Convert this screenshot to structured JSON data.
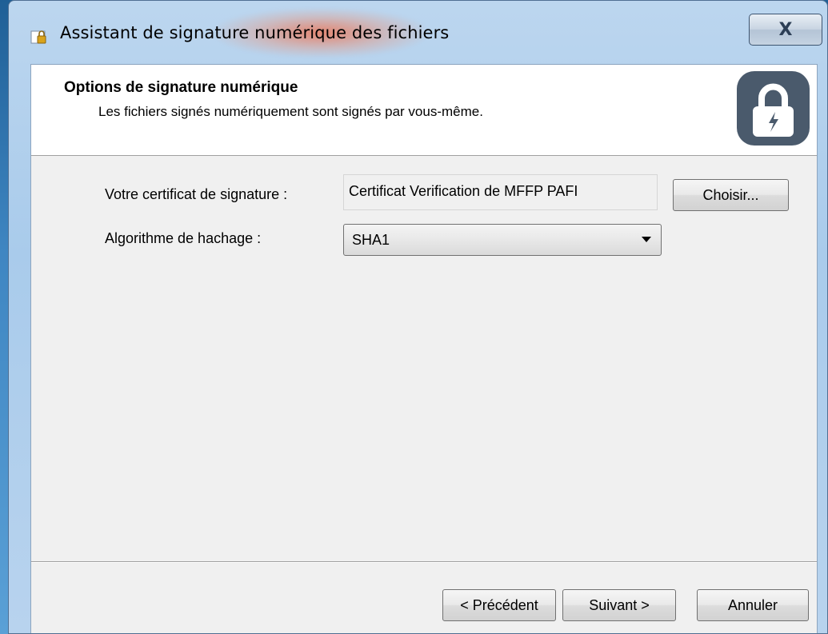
{
  "window": {
    "title": "Assistant de signature numérique des fichiers",
    "close_label": "X"
  },
  "header": {
    "title": "Options de signature numérique",
    "subtitle": "Les fichiers signés numériquement sont signés par vous-même.",
    "icon": "lock-icon"
  },
  "form": {
    "certificate_label": "Votre certificat de signature :",
    "certificate_value": "Certificat Verification de MFFP PAFI",
    "choose_label": "Choisir...",
    "hash_label": "Algorithme de hachage :",
    "hash_value": "SHA1"
  },
  "footer": {
    "previous_label": "< Précédent",
    "next_label": "Suivant >",
    "cancel_label": "Annuler"
  },
  "colors": {
    "lock_bg": "#4a5a6c",
    "window_frame": "#bcd6ef"
  }
}
